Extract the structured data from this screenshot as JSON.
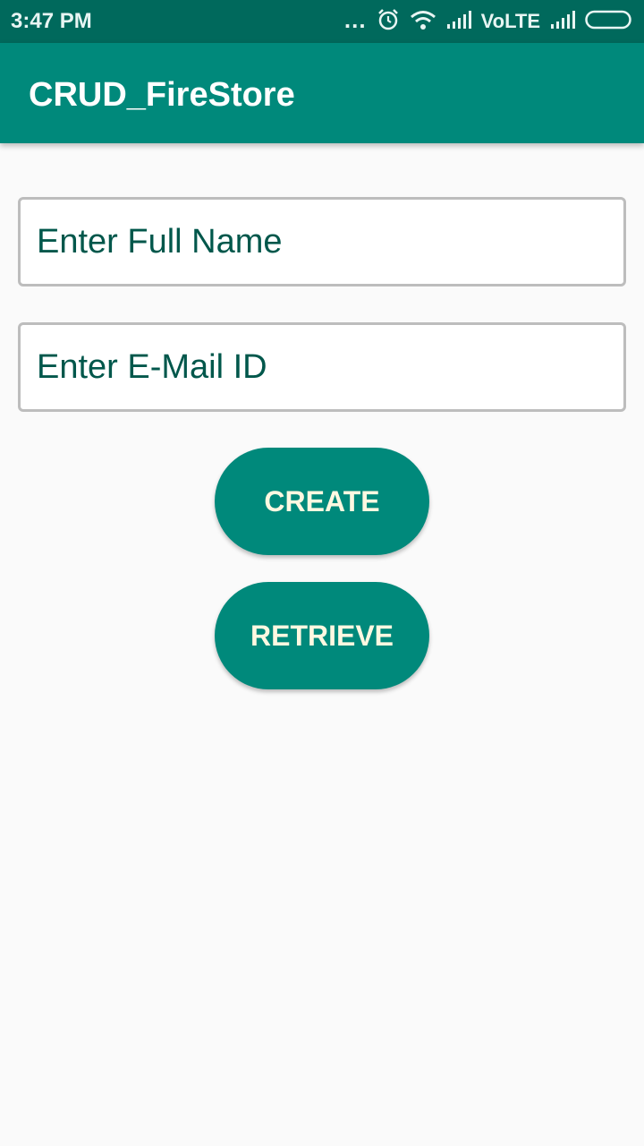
{
  "status_bar": {
    "time": "3:47 PM",
    "dots": "...",
    "network": "VoLTE",
    "icons": [
      "alarm-icon",
      "wifi-icon",
      "signal-icon",
      "signal-icon",
      "battery-icon"
    ]
  },
  "app_bar": {
    "title": "CRUD_FireStore"
  },
  "form": {
    "name_placeholder": "Enter Full Name",
    "name_value": "",
    "email_placeholder": "Enter E-Mail ID",
    "email_value": ""
  },
  "buttons": {
    "create_label": "CREATE",
    "retrieve_label": "RETRIEVE"
  },
  "colors": {
    "status_bar": "#00695c",
    "primary": "#00897b",
    "button_text": "#fff8e1",
    "hint_text": "#00574b",
    "background": "#fafafa"
  }
}
